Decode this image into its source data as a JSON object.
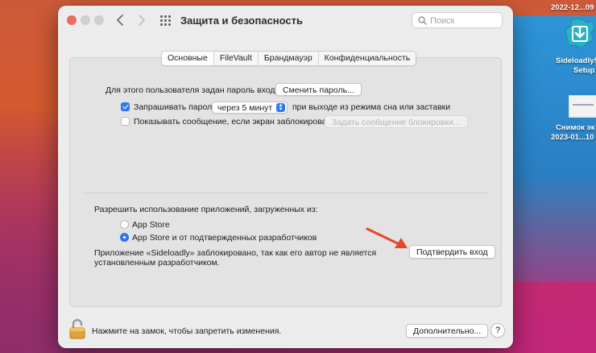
{
  "desktop": {
    "date_label": "2022-12...09",
    "app_name_line1": "Sideloadly!",
    "app_name_line2": "Setup",
    "screenshot_line1": "Снимок эк",
    "screenshot_line2": "2023-01...10"
  },
  "window": {
    "title": "Защита и безопасность",
    "search_placeholder": "Поиск",
    "tabs": [
      {
        "label": "Основные",
        "active": true
      },
      {
        "label": "FileVault",
        "active": false
      },
      {
        "label": "Брандмауэр",
        "active": false
      },
      {
        "label": "Конфиденциальность",
        "active": false
      }
    ]
  },
  "general": {
    "password_text": "Для этого пользователя задан пароль входа",
    "change_password_button": "Сменить пароль...",
    "require_password_label": "Запрашивать пароль",
    "require_password_checked": true,
    "require_password_delay": "через 5 минут",
    "require_password_suffix": "при выходе из режима сна или заставки",
    "show_message_label": "Показывать сообщение, если экран заблокирован",
    "show_message_checked": false,
    "set_lock_message_button": "Задать сообщение блокировки...",
    "allow_apps_heading": "Разрешить использование приложений, загруженных из:",
    "radio_app_store": "App Store",
    "radio_app_store_identified": "App Store и от подтвержденных разработчиков",
    "selected_radio": "app_store_identified",
    "blocked_message_line1": "Приложение «Sideloadly» заблокировано, так как его автор не является",
    "blocked_message_line2": "установленным разработчиком.",
    "open_anyway_button": "Подтвердить вход"
  },
  "footer": {
    "lock_text": "Нажмите на замок, чтобы запретить изменения.",
    "advanced_button": "Дополнительно...",
    "help_button": "?"
  },
  "colors": {
    "accent": "#2f7bf5",
    "annotation_arrow": "#e8472b"
  }
}
